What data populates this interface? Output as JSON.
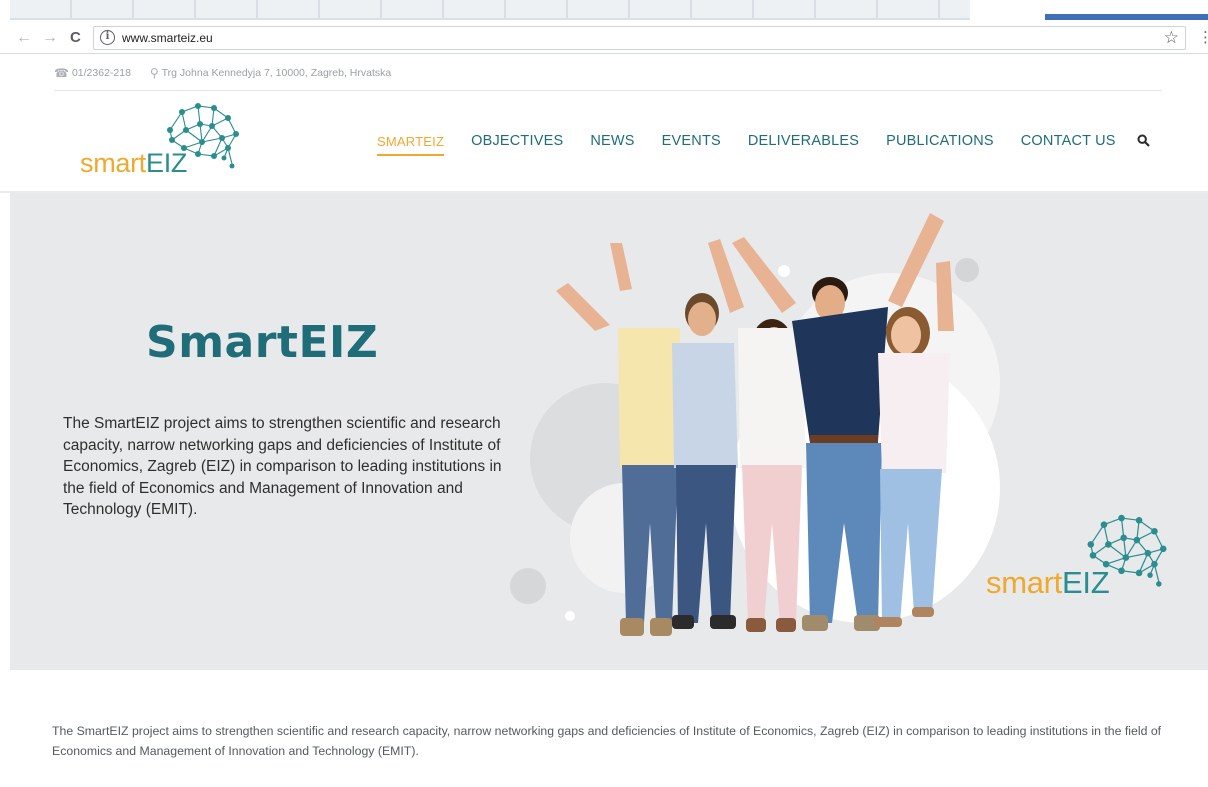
{
  "browser": {
    "url": "www.smarteiz.eu",
    "back_icon": "←",
    "forward_icon": "→",
    "reload_icon": "C",
    "info_icon": "i",
    "bookmark_icon": "☆",
    "menu_icon": "⋮"
  },
  "topbar": {
    "phone": "01/2362-218",
    "address": "Trg Johna Kennedyja 7, 10000, Zagreb, Hrvatska",
    "phone_icon": "☎",
    "pin_icon": "⚲"
  },
  "logo": {
    "prefix": "smart",
    "suffix": "EIZ"
  },
  "nav": {
    "items": [
      {
        "label": "SMARTEIZ",
        "active": true
      },
      {
        "label": "OBJECTIVES"
      },
      {
        "label": "NEWS"
      },
      {
        "label": "EVENTS"
      },
      {
        "label": "DELIVERABLES"
      },
      {
        "label": "PUBLICATIONS"
      },
      {
        "label": "CONTACT US"
      }
    ],
    "search_icon": "🔍"
  },
  "hero": {
    "title": "SmartEIZ",
    "lead": "The SmartEIZ project aims to strengthen scientific and research capacity, narrow networking gaps and deficiencies of Institute of Economics, Zagreb (EIZ) in comparison to leading institutions in the field of Economics and Management of Innovation and Technology (EMIT).",
    "logo_prefix": "smart",
    "logo_suffix": "EIZ"
  },
  "body": {
    "text": "The SmartEIZ project aims to strengthen scientific and research capacity, narrow networking gaps and deficiencies of Institute of Economics, Zagreb (EIZ) in comparison to leading institutions in the field of Economics and Management of Innovation and Technology (EMIT)."
  },
  "colors": {
    "brand_teal": "#1f6d78",
    "brand_orange": "#f0a82d",
    "hero_bg": "#e8e9ea"
  }
}
